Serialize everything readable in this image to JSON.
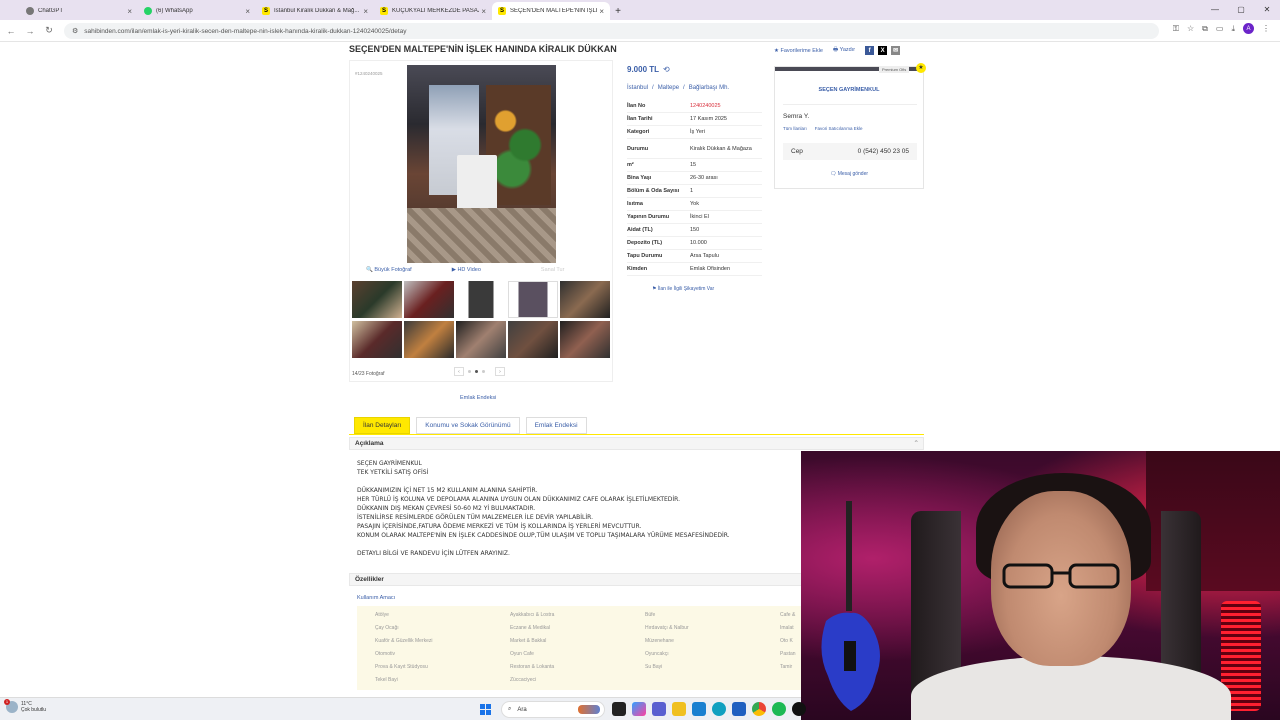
{
  "browser": {
    "tabs": [
      {
        "title": "ChatGPT",
        "favicon": "chatgpt-icon",
        "active": false
      },
      {
        "title": "(6) WhatsApp",
        "favicon": "whatsapp-icon",
        "active": false
      },
      {
        "title": "İstanbul Kiralık Dükkan & Mağ...",
        "favicon": "sahibinden-icon",
        "active": false
      },
      {
        "title": "KÜÇÜKYALI MERKEZDE PASAJ İ...",
        "favicon": "sahibinden-icon",
        "active": false
      },
      {
        "title": "SEÇEN'DEN MALTEPE'NİN İŞLEK...",
        "favicon": "sahibinden-icon",
        "active": true
      }
    ],
    "url": "sahibinden.com/ilan/emlak-is-yeri-kiralik-secen-den-maltepe-nin-islek-hanında-kiralik-dukkan-1240240025/detay"
  },
  "listing": {
    "title": "SEÇEN'DEN MALTEPE'NİN İŞLEK HANINDA KİRALIK DÜKKAN",
    "actions": {
      "favorite": "Favorilerime Ekle",
      "print": "Yazdır"
    },
    "small_id": "#1240240025",
    "price": "9.000 TL",
    "location": [
      "İstanbul",
      "/",
      "Maltepe",
      "/",
      "Bağlarbaşı Mh."
    ],
    "details": [
      {
        "k": "İlan No",
        "v": "1240240025",
        "red": true
      },
      {
        "k": "İlan Tarihi",
        "v": "17 Kasım 2025"
      },
      {
        "k": "Kategori",
        "v": "İş Yeri"
      },
      {
        "k": "Durumu",
        "v": "Kiralık Dükkan & Mağaza",
        "tall": true
      },
      {
        "k": "m²",
        "v": "15"
      },
      {
        "k": "Bina Yaşı",
        "v": "26-30 arası"
      },
      {
        "k": "Bölüm & Oda Sayısı",
        "v": "1"
      },
      {
        "k": "Isıtma",
        "v": "Yok"
      },
      {
        "k": "Yapının Durumu",
        "v": "İkinci El"
      },
      {
        "k": "Aidat (TL)",
        "v": "150"
      },
      {
        "k": "Depozito (TL)",
        "v": "10.000"
      },
      {
        "k": "Tapu Durumu",
        "v": "Arsa Tapulu"
      },
      {
        "k": "Kimden",
        "v": "Emlak Ofisinden"
      }
    ],
    "complain": "İlan ile İlgili Şikayetim Var",
    "gallery": {
      "big_photo": "Büyük Fotoğraf",
      "hd_video": "HD Video",
      "disabled_link": "Sanal Tur",
      "count": "14/23 Fotoğraf",
      "emlak_endeksi": "Emlak Endeksi"
    }
  },
  "seller": {
    "premium": "Premium Ofis",
    "store": "SEÇEN GAYRİMENKUL",
    "name": "Semra Y.",
    "all_listings": "Tüm İlanları",
    "add_fav_seller": "Favori Satıcılarıma Ekle",
    "phone_label": "Cep",
    "phone": "0 (542) 450 23 05",
    "message": "Mesaj gönder"
  },
  "tabs": [
    "İlan Detayları",
    "Konumu ve Sokak Görünümü",
    "Emlak Endeksi"
  ],
  "description": {
    "header": "Açıklama",
    "lines": [
      "SEÇEN GAYRİMENKUL",
      "TEK YETKİLİ SATIŞ OFİSİ",
      "",
      "DÜKKANIMIZIN İÇİ NET 15 M2 KULLANIM ALANINA SAHİPTİR.",
      "HER TÜRLÜ İŞ KOLUNA VE DEPOLAMA ALANINA UYGUN OLAN DÜKKANIMIZ CAFE OLARAK İŞLETİLMEKTEDİR.",
      "DÜKKANIN DIŞ MEKAN ÇEVRESİ 50-60 M2 Yİ BULMAKTADIR.",
      "İSTENİLİRSE RESİMLERDE GÖRÜLEN TÜM MALZEMELER İLE DEVİR YAPILABİLİR.",
      "PASAJIN İÇERİSİNDE,FATURA ÖDEME MERKEZİ VE TÜM İŞ KOLLARINDA İŞ YERLERİ MEVCUTTUR.",
      "KONUM OLARAK MALTEPE'NİN EN İŞLEK CADDESİNDE OLUP,TÜM ULAŞIM VE TOPLU TAŞIMALARA YÜRÜME MESAFESİNDEDİR.",
      "",
      "DETAYLI BİLGİ VE RANDEVU İÇİN LÜTFEN ARAYINIZ."
    ]
  },
  "features": {
    "header": "Özellikler",
    "subtitle": "Kullanım Amacı",
    "items": [
      "Atölye",
      "Ayakkabıcı & Lostra",
      "Büfe",
      "Cafe &",
      "Çay Ocağı",
      "Eczane & Medikal",
      "Hırdavatçı & Nalbur",
      "İmalat",
      "Kuaför & Güzellik Merkezi",
      "Market & Bakkal",
      "Müzenehane",
      "Oto K",
      "Otomotiv",
      "Oyun Cafe",
      "Oyuncakçı",
      "Pastan",
      "Prova & Kayıt Stüdyosu",
      "Restoran & Lokanta",
      "Su Bayi",
      "Tamir",
      "Tekel Bayi",
      "Züccaciyeci",
      "",
      ""
    ]
  },
  "taskbar": {
    "temp": "11°C",
    "weather": "Çok bulutlu",
    "search": "Ara",
    "badge": "1"
  },
  "colors": {
    "accent_yellow": "#ffe800",
    "link_blue": "#3a5ea8",
    "red": "#d9303c"
  }
}
